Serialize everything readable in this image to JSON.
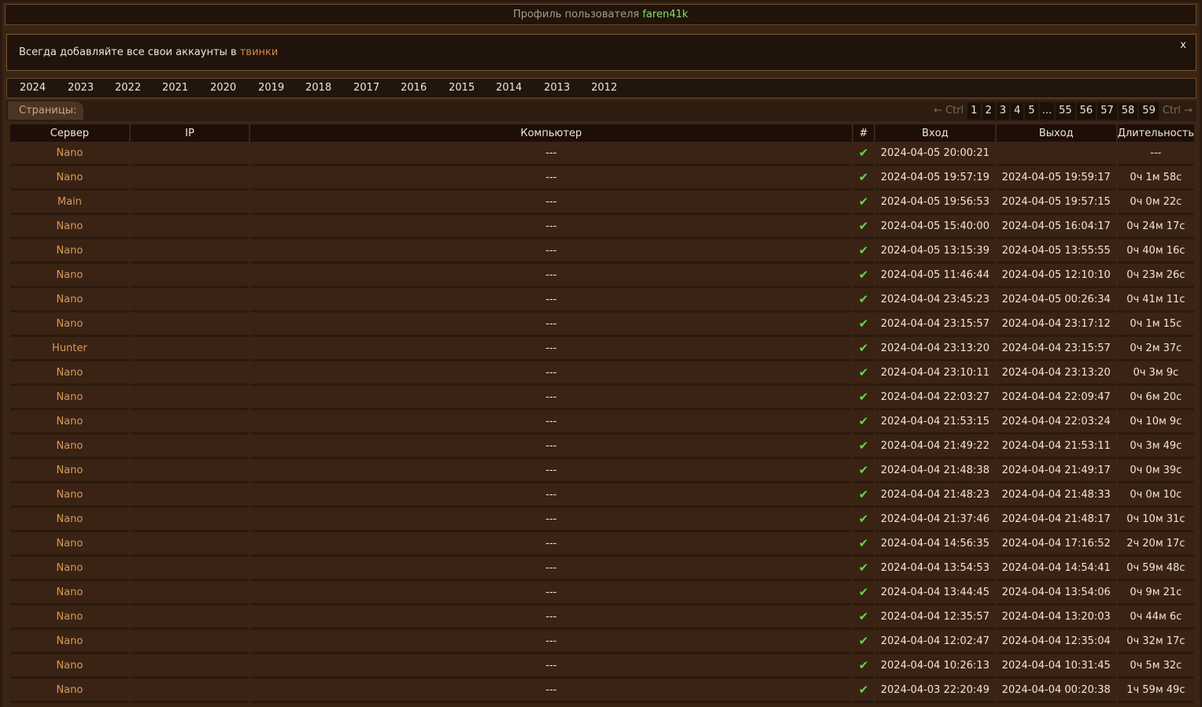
{
  "header": {
    "prefix": "Профиль пользователя",
    "username": "faren41k"
  },
  "notice": {
    "text": "Всегда добавляйте все свои аккаунты в",
    "link": "твинки",
    "close": "x"
  },
  "years": [
    "2024",
    "2023",
    "2022",
    "2021",
    "2020",
    "2019",
    "2018",
    "2017",
    "2016",
    "2015",
    "2014",
    "2013",
    "2012"
  ],
  "pages": {
    "label": "Страницы:",
    "prev": "← Ctrl",
    "next": "Ctrl →",
    "items": [
      "1",
      "2",
      "3",
      "4",
      "5",
      "...",
      "55",
      "56",
      "57",
      "58",
      "59"
    ]
  },
  "table": {
    "columns": [
      "Сервер",
      "IP",
      "Компьютер",
      "#",
      "Вход",
      "Выход",
      "Длительность"
    ],
    "rows": [
      {
        "server": "Nano",
        "ip": "",
        "computer": "---",
        "in": "2024-04-05 20:00:21",
        "out": "",
        "dur": "---"
      },
      {
        "server": "Nano",
        "ip": "",
        "computer": "---",
        "in": "2024-04-05 19:57:19",
        "out": "2024-04-05 19:59:17",
        "dur": "0ч 1м 58с"
      },
      {
        "server": "Main",
        "ip": "",
        "computer": "---",
        "in": "2024-04-05 19:56:53",
        "out": "2024-04-05 19:57:15",
        "dur": "0ч 0м 22с"
      },
      {
        "server": "Nano",
        "ip": "",
        "computer": "---",
        "in": "2024-04-05 15:40:00",
        "out": "2024-04-05 16:04:17",
        "dur": "0ч 24м 17с"
      },
      {
        "server": "Nano",
        "ip": "",
        "computer": "---",
        "in": "2024-04-05 13:15:39",
        "out": "2024-04-05 13:55:55",
        "dur": "0ч 40м 16с"
      },
      {
        "server": "Nano",
        "ip": "",
        "computer": "---",
        "in": "2024-04-05 11:46:44",
        "out": "2024-04-05 12:10:10",
        "dur": "0ч 23м 26с"
      },
      {
        "server": "Nano",
        "ip": "",
        "computer": "---",
        "in": "2024-04-04 23:45:23",
        "out": "2024-04-05 00:26:34",
        "dur": "0ч 41м 11с"
      },
      {
        "server": "Nano",
        "ip": "",
        "computer": "---",
        "in": "2024-04-04 23:15:57",
        "out": "2024-04-04 23:17:12",
        "dur": "0ч 1м 15с"
      },
      {
        "server": "Hunter",
        "ip": "",
        "computer": "---",
        "in": "2024-04-04 23:13:20",
        "out": "2024-04-04 23:15:57",
        "dur": "0ч 2м 37с"
      },
      {
        "server": "Nano",
        "ip": "",
        "computer": "---",
        "in": "2024-04-04 23:10:11",
        "out": "2024-04-04 23:13:20",
        "dur": "0ч 3м 9с"
      },
      {
        "server": "Nano",
        "ip": "",
        "computer": "---",
        "in": "2024-04-04 22:03:27",
        "out": "2024-04-04 22:09:47",
        "dur": "0ч 6м 20с"
      },
      {
        "server": "Nano",
        "ip": "",
        "computer": "---",
        "in": "2024-04-04 21:53:15",
        "out": "2024-04-04 22:03:24",
        "dur": "0ч 10м 9с"
      },
      {
        "server": "Nano",
        "ip": "",
        "computer": "---",
        "in": "2024-04-04 21:49:22",
        "out": "2024-04-04 21:53:11",
        "dur": "0ч 3м 49с"
      },
      {
        "server": "Nano",
        "ip": "",
        "computer": "---",
        "in": "2024-04-04 21:48:38",
        "out": "2024-04-04 21:49:17",
        "dur": "0ч 0м 39с"
      },
      {
        "server": "Nano",
        "ip": "",
        "computer": "---",
        "in": "2024-04-04 21:48:23",
        "out": "2024-04-04 21:48:33",
        "dur": "0ч 0м 10с"
      },
      {
        "server": "Nano",
        "ip": "",
        "computer": "---",
        "in": "2024-04-04 21:37:46",
        "out": "2024-04-04 21:48:17",
        "dur": "0ч 10м 31с"
      },
      {
        "server": "Nano",
        "ip": "",
        "computer": "---",
        "in": "2024-04-04 14:56:35",
        "out": "2024-04-04 17:16:52",
        "dur": "2ч 20м 17с"
      },
      {
        "server": "Nano",
        "ip": "",
        "computer": "---",
        "in": "2024-04-04 13:54:53",
        "out": "2024-04-04 14:54:41",
        "dur": "0ч 59м 48с"
      },
      {
        "server": "Nano",
        "ip": "",
        "computer": "---",
        "in": "2024-04-04 13:44:45",
        "out": "2024-04-04 13:54:06",
        "dur": "0ч 9м 21с"
      },
      {
        "server": "Nano",
        "ip": "",
        "computer": "---",
        "in": "2024-04-04 12:35:57",
        "out": "2024-04-04 13:20:03",
        "dur": "0ч 44м 6с"
      },
      {
        "server": "Nano",
        "ip": "",
        "computer": "---",
        "in": "2024-04-04 12:02:47",
        "out": "2024-04-04 12:35:04",
        "dur": "0ч 32м 17с"
      },
      {
        "server": "Nano",
        "ip": "",
        "computer": "---",
        "in": "2024-04-04 10:26:13",
        "out": "2024-04-04 10:31:45",
        "dur": "0ч 5м 32с"
      },
      {
        "server": "Nano",
        "ip": "",
        "computer": "---",
        "in": "2024-04-03 22:20:49",
        "out": "2024-04-04 00:20:38",
        "dur": "1ч 59м 49с"
      }
    ]
  },
  "colors": {
    "background": "#2b1a0f",
    "accent_link": "#d08a4a",
    "username": "#7de36a",
    "check": "#5fd84a"
  },
  "icons": {
    "status": "check-icon"
  }
}
